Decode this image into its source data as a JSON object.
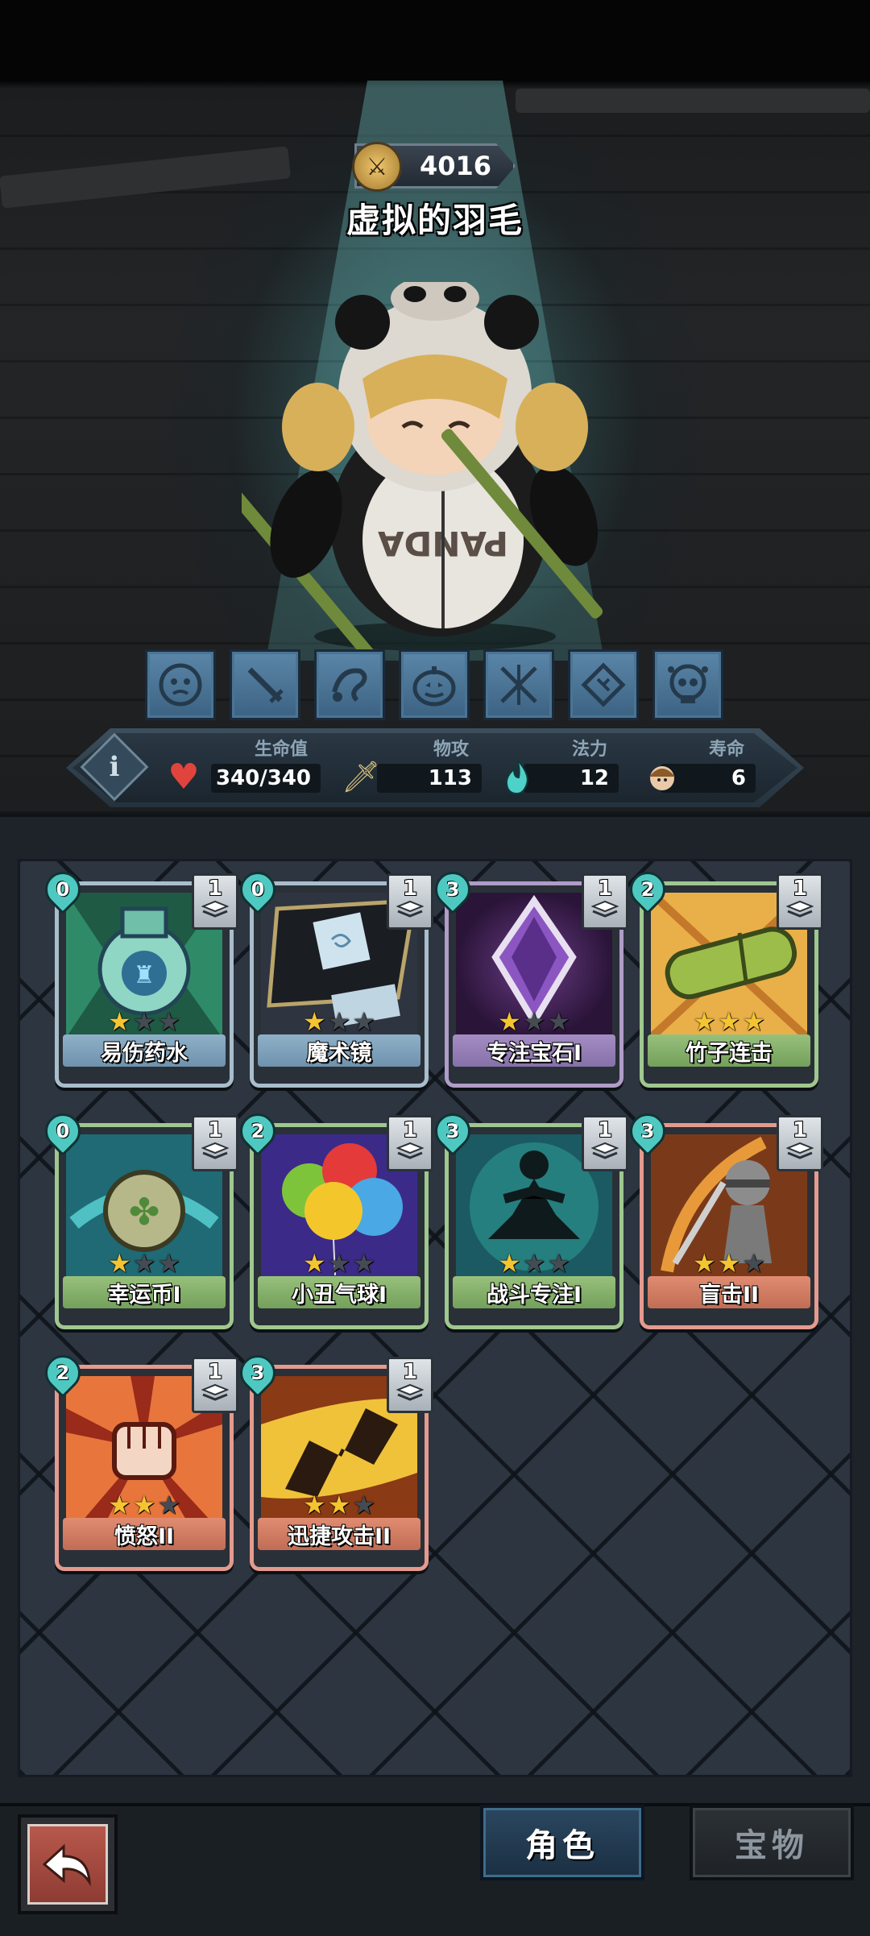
{
  "hero": {
    "power": "4016",
    "name": "虚拟的羽毛"
  },
  "skills": [
    "face-icon",
    "sword-icon",
    "scroll-icon",
    "pumpkin-icon",
    "crossed-swords-icon",
    "rune-icon",
    "skull-icon"
  ],
  "stats": {
    "hp_label": "生命值",
    "hp_value": "340/340",
    "atk_label": "物攻",
    "atk_value": "113",
    "mana_label": "法力",
    "mana_value": "12",
    "life_label": "寿命",
    "life_value": "6"
  },
  "cards": [
    {
      "name": "易伤药水",
      "cost": "0",
      "level": "1",
      "stars": 1,
      "rarity": "blue",
      "art": "potion"
    },
    {
      "name": "魔术镜",
      "cost": "0",
      "level": "1",
      "stars": 1,
      "rarity": "blue",
      "art": "mirror"
    },
    {
      "name": "专注宝石I",
      "cost": "3",
      "level": "1",
      "stars": 1,
      "rarity": "purple",
      "art": "gem"
    },
    {
      "name": "竹子连击",
      "cost": "2",
      "level": "1",
      "stars": 3,
      "rarity": "green",
      "art": "bamboo"
    },
    {
      "name": "幸运币I",
      "cost": "0",
      "level": "1",
      "stars": 1,
      "rarity": "green",
      "art": "coin"
    },
    {
      "name": "小丑气球I",
      "cost": "2",
      "level": "1",
      "stars": 1,
      "rarity": "green",
      "art": "balloon"
    },
    {
      "name": "战斗专注I",
      "cost": "3",
      "level": "1",
      "stars": 1,
      "rarity": "green",
      "art": "meditate"
    },
    {
      "name": "盲击II",
      "cost": "3",
      "level": "1",
      "stars": 2,
      "rarity": "red",
      "art": "blind"
    },
    {
      "name": "愤怒II",
      "cost": "2",
      "level": "1",
      "stars": 2,
      "rarity": "red",
      "art": "fist"
    },
    {
      "name": "迅捷攻击II",
      "cost": "3",
      "level": "1",
      "stars": 2,
      "rarity": "red",
      "art": "swift"
    }
  ],
  "nav": {
    "tab_character": "角色",
    "tab_treasure": "宝物"
  }
}
